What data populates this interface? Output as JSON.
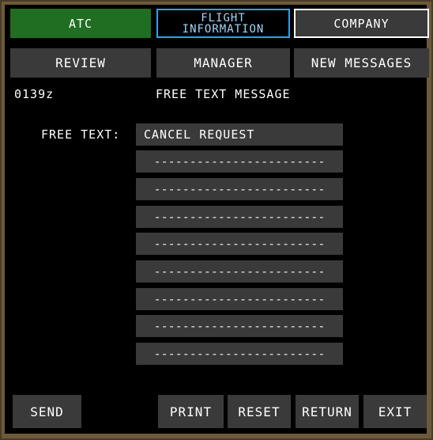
{
  "tabs": {
    "atc": "ATC",
    "flight_line1": "FLIGHT",
    "flight_line2": "INFORMATION",
    "company": "COMPANY"
  },
  "nav": {
    "review": "REVIEW",
    "manager": "MANAGER",
    "new_messages": "NEW MESSAGES"
  },
  "header": {
    "time": "0139z",
    "title": "FREE TEXT MESSAGE"
  },
  "form": {
    "label": "FREE TEXT:",
    "lines": [
      "CANCEL REQUEST",
      "------------------------",
      "------------------------",
      "------------------------",
      "------------------------",
      "------------------------",
      "------------------------",
      "------------------------",
      "------------------------"
    ]
  },
  "footer": {
    "send": "SEND",
    "print": "PRINT",
    "reset": "RESET",
    "return": "RETURN",
    "exit": "EXIT"
  },
  "colors": {
    "background": "#000000",
    "button": "#3a3a3a",
    "atc_active": "#1f6e21",
    "flight_info_border": "#2aa3e6",
    "bezel": "#6b5a3a"
  }
}
